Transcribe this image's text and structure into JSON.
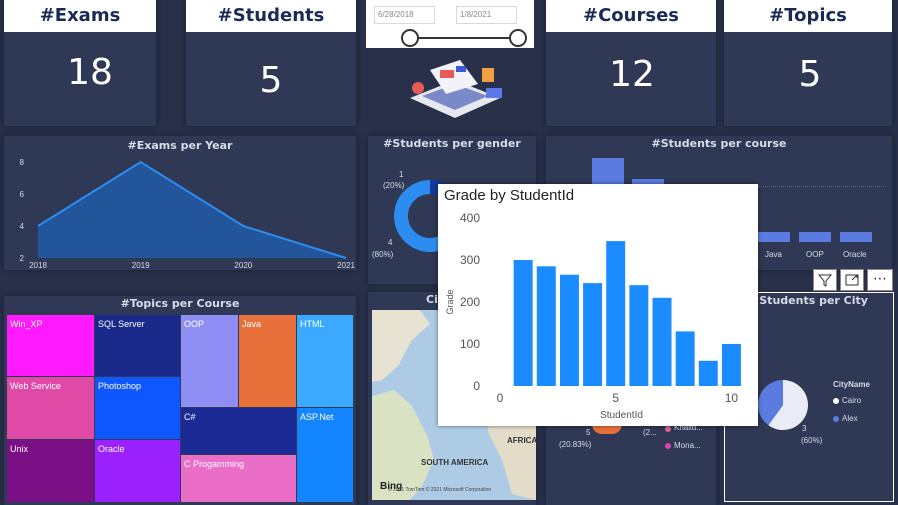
{
  "kpis": [
    {
      "title": "#Exams",
      "value": "18"
    },
    {
      "title": "#Students",
      "value": "5"
    },
    {
      "title": "#Courses",
      "value": "12"
    },
    {
      "title": "#Topics",
      "value": "5"
    }
  ],
  "date_slicer": {
    "start": "6/28/2018",
    "end": "1/8/2021"
  },
  "exams_per_year": {
    "title": "#Exams per Year",
    "chart_data": {
      "type": "area",
      "x": [
        2018,
        2019,
        2020,
        2021
      ],
      "y": [
        4,
        8,
        4,
        2
      ],
      "x_ticks": [
        "2018",
        "2019",
        "2020",
        "2021"
      ],
      "y_ticks": [
        "2",
        "4",
        "6",
        "8"
      ],
      "ylim": [
        2,
        8
      ],
      "color": "#2d8cf0"
    }
  },
  "students_per_gender": {
    "title": "#Students per gender",
    "labels": [
      {
        "count": "1",
        "pct": "(20%)"
      },
      {
        "count": "4",
        "pct": "(80%)"
      }
    ],
    "chart_data": {
      "type": "pie",
      "values": [
        1,
        4
      ],
      "colors": [
        "#123a9c",
        "#2d8cf0"
      ]
    }
  },
  "students_per_course": {
    "title": "#Students per course",
    "visible_categories": [
      "Java",
      "OOP",
      "Oracle"
    ]
  },
  "toolbar": {
    "filter_icon": "filter-icon",
    "focus_icon": "focus-mode-icon",
    "more_label": "⋯"
  },
  "tooltip": {
    "title": "Grade by StudentId",
    "chart_data": {
      "type": "bar",
      "x": [
        1,
        2,
        3,
        4,
        5,
        6,
        7,
        8,
        9,
        10
      ],
      "values": [
        300,
        285,
        265,
        245,
        345,
        240,
        210,
        130,
        60,
        100
      ],
      "xlabel": "StudentId",
      "ylabel": "Grade",
      "x_ticks": [
        "0",
        "5",
        "10"
      ],
      "y_ticks": [
        "0",
        "100",
        "200",
        "300",
        "400"
      ],
      "xlim": [
        0,
        10.5
      ],
      "ylim": [
        0,
        400
      ],
      "color": "#1b8cff"
    }
  },
  "topics_per_course": {
    "title": "#Topics per Course",
    "tiles": [
      {
        "label": "Win_XP",
        "color": "#ff19ff"
      },
      {
        "label": "SQL Server",
        "color": "#1a2a8a"
      },
      {
        "label": "OOP",
        "color": "#8f8ef4"
      },
      {
        "label": "Java",
        "color": "#e8703a"
      },
      {
        "label": "HTML",
        "color": "#3aa9ff"
      },
      {
        "label": "Web Service",
        "color": "#e04aa6"
      },
      {
        "label": "Photoshop",
        "color": "#0e57ff"
      },
      {
        "label": "C#",
        "color": "#1c2a95"
      },
      {
        "label": "ASP.Net",
        "color": "#1386ff"
      },
      {
        "label": "Unix",
        "color": "#7a0f86"
      },
      {
        "label": "Oracle",
        "color": "#9b22ff"
      },
      {
        "label": "C Progamming",
        "color": "#ea6dc7"
      }
    ]
  },
  "map": {
    "title_partial": "Cit",
    "label_africa": "AFRICA",
    "label_south_america": "SOUTH AMERICA",
    "bing": "Bing",
    "copyright": "© 2021 TomTom © 2021 Microsoft Corporation"
  },
  "students_per_city_left": {
    "labels": [
      "Khalid...",
      "Mona..."
    ],
    "pct_label_value": "5",
    "pct_label": "(20.83%)",
    "short_label": "(2..."
  },
  "students_per_city": {
    "title": "#Students per City",
    "legend_title": "CityName",
    "legend": [
      {
        "label": "Cairo",
        "color": "#ffffff"
      },
      {
        "label": "Alex",
        "color": "#5b7be0"
      }
    ],
    "slice_value": "3",
    "slice_pct": "(60%)",
    "chart_data": {
      "type": "pie",
      "values": [
        60,
        40
      ],
      "colors": [
        "#e9ecf4",
        "#5b7be0"
      ]
    }
  }
}
